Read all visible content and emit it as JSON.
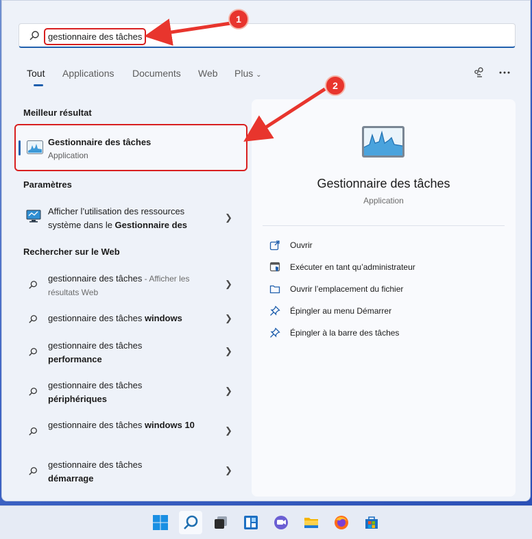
{
  "search": {
    "query": "gestionnaire des tâches"
  },
  "tabs": [
    {
      "label": "Tout"
    },
    {
      "label": "Applications"
    },
    {
      "label": "Documents"
    },
    {
      "label": "Web"
    },
    {
      "label": "Plus"
    }
  ],
  "best_match": {
    "section": "Meilleur résultat",
    "name": "Gestionnaire des tâches",
    "type": "Application",
    "icon": "task-manager-icon"
  },
  "settings": {
    "section": "Paramètres",
    "item": {
      "text_before": "Afficher l’utilisation des ressources système dans le ",
      "text_bold": "Gestionnaire des",
      "icon": "monitor-settings-icon"
    }
  },
  "web": {
    "section": "Rechercher sur le Web",
    "items": [
      {
        "plain": "gestionnaire des tâches",
        "muted": " - Afficher les résultats Web",
        "bold": ""
      },
      {
        "plain": "gestionnaire des tâches ",
        "bold": "windows",
        "muted": ""
      },
      {
        "plain": "gestionnaire des tâches ",
        "bold": "performance",
        "muted": ""
      },
      {
        "plain": "gestionnaire des tâches ",
        "bold": "périphériques",
        "muted": ""
      },
      {
        "plain": "gestionnaire des tâches ",
        "bold": "windows 10",
        "muted": ""
      },
      {
        "plain": "gestionnaire des tâches ",
        "bold": "démarrage",
        "muted": ""
      }
    ]
  },
  "details": {
    "title": "Gestionnaire des tâches",
    "subtitle": "Application",
    "actions": [
      {
        "label": "Ouvrir",
        "icon": "open-icon"
      },
      {
        "label": "Exécuter en tant qu’administrateur",
        "icon": "admin-shield-icon"
      },
      {
        "label": "Ouvrir l’emplacement du fichier",
        "icon": "folder-icon"
      },
      {
        "label": "Épingler au menu Démarrer",
        "icon": "pin-icon"
      },
      {
        "label": "Épingler à la barre des tâches",
        "icon": "pin-icon"
      }
    ]
  },
  "annotations": [
    {
      "number": "1"
    },
    {
      "number": "2"
    }
  ],
  "taskbar": [
    "windows-start-icon",
    "search-icon",
    "task-view-icon",
    "widgets-icon",
    "teams-chat-icon",
    "file-explorer-icon",
    "firefox-icon",
    "microsoft-store-icon"
  ],
  "colors": {
    "accent": "#1f5fad",
    "annotation": "#e8352d"
  }
}
